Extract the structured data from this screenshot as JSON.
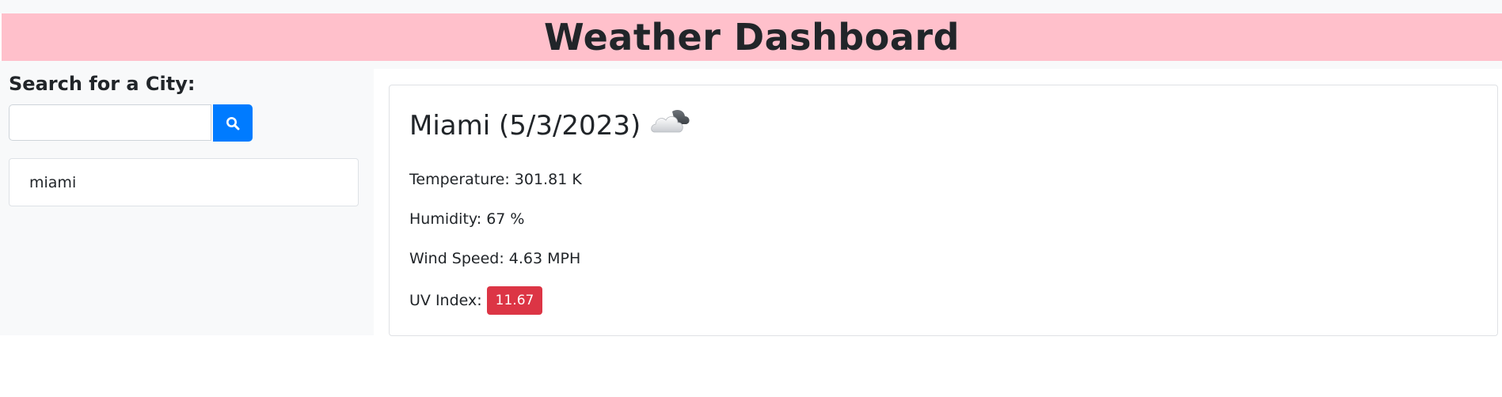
{
  "header": {
    "title": "Weather Dashboard"
  },
  "sidebar": {
    "search_label": "Search for a City:",
    "search_input_value": "",
    "search_input_placeholder": "",
    "search_button_icon": "search-icon",
    "history": [
      {
        "label": "miami"
      }
    ]
  },
  "current": {
    "title": "Miami (5/3/2023)",
    "weather_icon": "cloud-icon",
    "temperature": "Temperature: 301.81 K",
    "humidity": "Humidity: 67 %",
    "wind_speed": "Wind Speed: 4.63 MPH",
    "uv_label": "UV Index:",
    "uv_value": "11.67"
  },
  "colors": {
    "header_bg": "#ffc0cb",
    "page_bg": "#f8f9fa",
    "button_bg": "#007bff",
    "uv_badge_bg": "#dc3545"
  }
}
